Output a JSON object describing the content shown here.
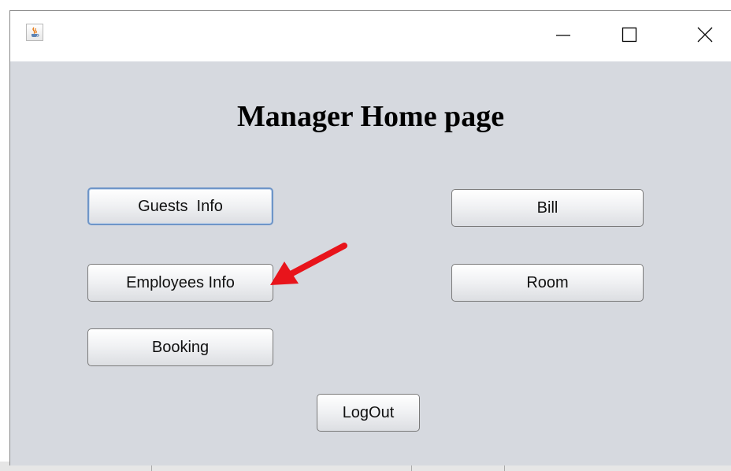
{
  "window": {
    "title": "",
    "controls": {
      "minimize_icon": "minimize-icon",
      "maximize_icon": "maximize-icon",
      "close_icon": "close-icon"
    },
    "app_icon": "java-cup-icon"
  },
  "page": {
    "title": "Manager Home page"
  },
  "buttons": {
    "guests_info": "Guests  Info",
    "bill": "Bill",
    "employees_info": "Employees Info",
    "room": "Room",
    "booking": "Booking",
    "logout": "LogOut"
  },
  "annotation": {
    "arrow_color": "#e8141b",
    "points_to": "employees-info-button"
  },
  "colors": {
    "window_bg": "#d6d9df",
    "titlebar_bg": "#ffffff",
    "focus_border": "#6e95c8"
  }
}
